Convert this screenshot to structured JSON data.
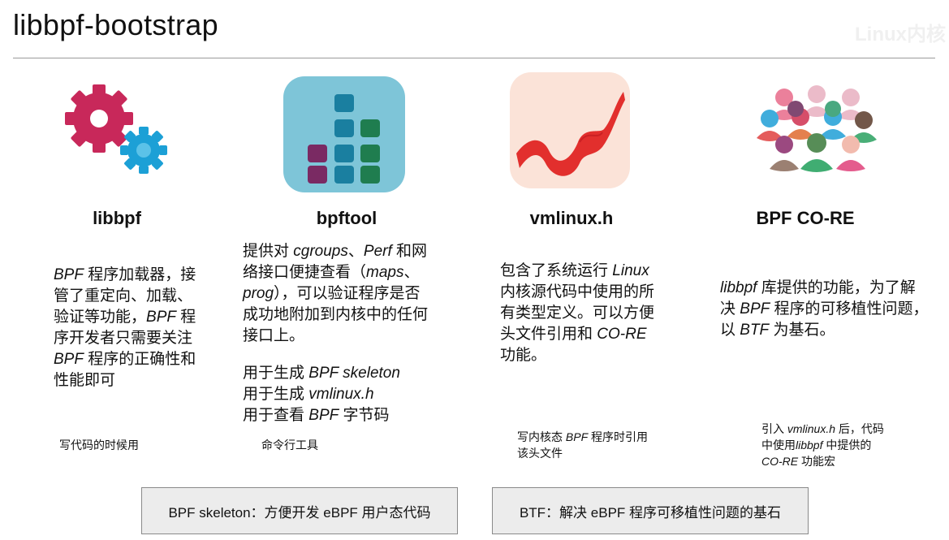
{
  "header": {
    "title": "libbpf-bootstrap",
    "watermark": "Linux内核"
  },
  "columns": [
    {
      "icon": "gears-icon",
      "title": "libbpf",
      "desc": [
        [
          {
            "t": "BPF",
            "i": true
          },
          {
            "t": " 程序加载器，接"
          }
        ],
        [
          {
            "t": "管了重定向、加载、"
          }
        ],
        [
          {
            "t": "验证等功能，"
          },
          {
            "t": "BPF",
            "i": true
          },
          {
            "t": " 程"
          }
        ],
        [
          {
            "t": "序开发者只需要关注"
          }
        ],
        [
          {
            "t": "BPF",
            "i": true
          },
          {
            "t": "  程序的正确性和"
          }
        ],
        [
          {
            "t": "性能即可"
          }
        ]
      ],
      "note": [
        [
          {
            "t": "写代码的时候用"
          }
        ]
      ],
      "colors": {
        "large_gear": "#c8285a",
        "small_gear": "#1ca0d6"
      }
    },
    {
      "icon": "bar-chart-app-icon",
      "title": "bpftool",
      "desc": [
        [
          {
            "t": "提供对 "
          },
          {
            "t": "cgroups",
            "i": true
          },
          {
            "t": "、"
          },
          {
            "t": "Perf",
            "i": true
          },
          {
            "t": " 和网"
          }
        ],
        [
          {
            "t": "络接口便捷查看（"
          },
          {
            "t": "maps",
            "i": true
          },
          {
            "t": "、"
          }
        ],
        [
          {
            "t": "prog",
            "i": true
          },
          {
            "t": "），可以验证程序是否"
          }
        ],
        [
          {
            "t": "成功地附加到内核中的任何"
          }
        ],
        [
          {
            "t": "接口上。"
          }
        ]
      ],
      "uses": [
        [
          {
            "t": "用于生成 "
          },
          {
            "t": "BPF skeleton",
            "i": true
          }
        ],
        [
          {
            "t": "用于生成 "
          },
          {
            "t": "vmlinux.h",
            "i": true
          }
        ],
        [
          {
            "t": "用于查看 "
          },
          {
            "t": "BPF",
            "i": true
          },
          {
            "t": " 字节码"
          }
        ]
      ],
      "note": [
        [
          {
            "t": "命令行工具"
          }
        ]
      ],
      "colors": {
        "tile_bg": "#7ec5d8",
        "blue": "#1a7fa0",
        "green": "#1f7d4f",
        "purple": "#7a2a63"
      }
    },
    {
      "icon": "red-ribbon-icon",
      "title": "vmlinux.h",
      "desc": [
        [
          {
            "t": "包含了系统运行 "
          },
          {
            "t": "Linux",
            "i": true
          }
        ],
        [
          {
            "t": "内核源代码中使用的所"
          }
        ],
        [
          {
            "t": "有类型定义。可以方便"
          }
        ],
        [
          {
            "t": "头文件引用和 "
          },
          {
            "t": "CO-RE",
            "i": true
          }
        ],
        [
          {
            "t": "功能。"
          }
        ]
      ],
      "note": [
        [
          {
            "t": "写内核态 "
          },
          {
            "t": "BPF",
            "i": true
          },
          {
            "t": "  程序时引用"
          }
        ],
        [
          {
            "t": "该头文件"
          }
        ]
      ],
      "colors": {
        "tile_bg": "#fbe3d8",
        "ribbon": "#e0201e"
      }
    },
    {
      "icon": "people-crowd-icon",
      "title": "BPF CO-RE",
      "desc": [
        [
          {
            "t": "libbpf",
            "i": true
          },
          {
            "t": " 库提供的功能，为了解"
          }
        ],
        [
          {
            "t": "决 "
          },
          {
            "t": "BPF",
            "i": true
          },
          {
            "t": " 程序的可移植性问题，"
          }
        ],
        [
          {
            "t": "以 "
          },
          {
            "t": "BTF",
            "i": true
          },
          {
            "t": "  为基石。"
          }
        ]
      ],
      "note": [
        [
          {
            "t": "引入 "
          },
          {
            "t": "vmlinux.h",
            "i": true
          },
          {
            "t": " 后，代码"
          }
        ],
        [
          {
            "t": "中使用"
          },
          {
            "t": "libbpf",
            "i": true
          },
          {
            "t": " 中提供的"
          }
        ],
        [
          {
            "t": "CO-RE",
            "i": true
          },
          {
            "t": " 功能宏"
          }
        ]
      ]
    }
  ],
  "boxes": [
    {
      "text": "BPF skeleton：方便开发 eBPF 用户态代码"
    },
    {
      "text": "BTF：解决 eBPF 程序可移植性问题的基石"
    }
  ]
}
